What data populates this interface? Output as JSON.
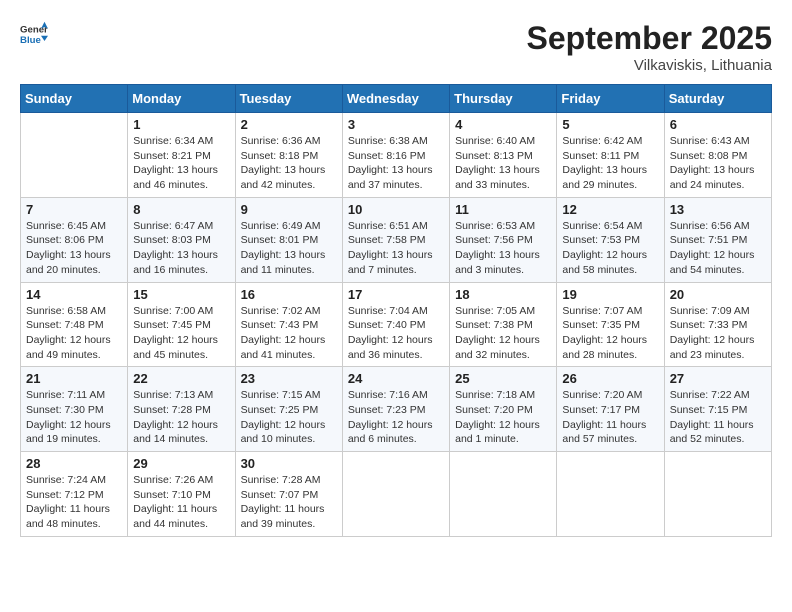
{
  "header": {
    "logo_general": "General",
    "logo_blue": "Blue",
    "month_title": "September 2025",
    "location": "Vilkaviskis, Lithuania"
  },
  "days_of_week": [
    "Sunday",
    "Monday",
    "Tuesday",
    "Wednesday",
    "Thursday",
    "Friday",
    "Saturday"
  ],
  "weeks": [
    [
      {
        "day": "",
        "info": ""
      },
      {
        "day": "1",
        "info": "Sunrise: 6:34 AM\nSunset: 8:21 PM\nDaylight: 13 hours\nand 46 minutes."
      },
      {
        "day": "2",
        "info": "Sunrise: 6:36 AM\nSunset: 8:18 PM\nDaylight: 13 hours\nand 42 minutes."
      },
      {
        "day": "3",
        "info": "Sunrise: 6:38 AM\nSunset: 8:16 PM\nDaylight: 13 hours\nand 37 minutes."
      },
      {
        "day": "4",
        "info": "Sunrise: 6:40 AM\nSunset: 8:13 PM\nDaylight: 13 hours\nand 33 minutes."
      },
      {
        "day": "5",
        "info": "Sunrise: 6:42 AM\nSunset: 8:11 PM\nDaylight: 13 hours\nand 29 minutes."
      },
      {
        "day": "6",
        "info": "Sunrise: 6:43 AM\nSunset: 8:08 PM\nDaylight: 13 hours\nand 24 minutes."
      }
    ],
    [
      {
        "day": "7",
        "info": "Sunrise: 6:45 AM\nSunset: 8:06 PM\nDaylight: 13 hours\nand 20 minutes."
      },
      {
        "day": "8",
        "info": "Sunrise: 6:47 AM\nSunset: 8:03 PM\nDaylight: 13 hours\nand 16 minutes."
      },
      {
        "day": "9",
        "info": "Sunrise: 6:49 AM\nSunset: 8:01 PM\nDaylight: 13 hours\nand 11 minutes."
      },
      {
        "day": "10",
        "info": "Sunrise: 6:51 AM\nSunset: 7:58 PM\nDaylight: 13 hours\nand 7 minutes."
      },
      {
        "day": "11",
        "info": "Sunrise: 6:53 AM\nSunset: 7:56 PM\nDaylight: 13 hours\nand 3 minutes."
      },
      {
        "day": "12",
        "info": "Sunrise: 6:54 AM\nSunset: 7:53 PM\nDaylight: 12 hours\nand 58 minutes."
      },
      {
        "day": "13",
        "info": "Sunrise: 6:56 AM\nSunset: 7:51 PM\nDaylight: 12 hours\nand 54 minutes."
      }
    ],
    [
      {
        "day": "14",
        "info": "Sunrise: 6:58 AM\nSunset: 7:48 PM\nDaylight: 12 hours\nand 49 minutes."
      },
      {
        "day": "15",
        "info": "Sunrise: 7:00 AM\nSunset: 7:45 PM\nDaylight: 12 hours\nand 45 minutes."
      },
      {
        "day": "16",
        "info": "Sunrise: 7:02 AM\nSunset: 7:43 PM\nDaylight: 12 hours\nand 41 minutes."
      },
      {
        "day": "17",
        "info": "Sunrise: 7:04 AM\nSunset: 7:40 PM\nDaylight: 12 hours\nand 36 minutes."
      },
      {
        "day": "18",
        "info": "Sunrise: 7:05 AM\nSunset: 7:38 PM\nDaylight: 12 hours\nand 32 minutes."
      },
      {
        "day": "19",
        "info": "Sunrise: 7:07 AM\nSunset: 7:35 PM\nDaylight: 12 hours\nand 28 minutes."
      },
      {
        "day": "20",
        "info": "Sunrise: 7:09 AM\nSunset: 7:33 PM\nDaylight: 12 hours\nand 23 minutes."
      }
    ],
    [
      {
        "day": "21",
        "info": "Sunrise: 7:11 AM\nSunset: 7:30 PM\nDaylight: 12 hours\nand 19 minutes."
      },
      {
        "day": "22",
        "info": "Sunrise: 7:13 AM\nSunset: 7:28 PM\nDaylight: 12 hours\nand 14 minutes."
      },
      {
        "day": "23",
        "info": "Sunrise: 7:15 AM\nSunset: 7:25 PM\nDaylight: 12 hours\nand 10 minutes."
      },
      {
        "day": "24",
        "info": "Sunrise: 7:16 AM\nSunset: 7:23 PM\nDaylight: 12 hours\nand 6 minutes."
      },
      {
        "day": "25",
        "info": "Sunrise: 7:18 AM\nSunset: 7:20 PM\nDaylight: 12 hours\nand 1 minute."
      },
      {
        "day": "26",
        "info": "Sunrise: 7:20 AM\nSunset: 7:17 PM\nDaylight: 11 hours\nand 57 minutes."
      },
      {
        "day": "27",
        "info": "Sunrise: 7:22 AM\nSunset: 7:15 PM\nDaylight: 11 hours\nand 52 minutes."
      }
    ],
    [
      {
        "day": "28",
        "info": "Sunrise: 7:24 AM\nSunset: 7:12 PM\nDaylight: 11 hours\nand 48 minutes."
      },
      {
        "day": "29",
        "info": "Sunrise: 7:26 AM\nSunset: 7:10 PM\nDaylight: 11 hours\nand 44 minutes."
      },
      {
        "day": "30",
        "info": "Sunrise: 7:28 AM\nSunset: 7:07 PM\nDaylight: 11 hours\nand 39 minutes."
      },
      {
        "day": "",
        "info": ""
      },
      {
        "day": "",
        "info": ""
      },
      {
        "day": "",
        "info": ""
      },
      {
        "day": "",
        "info": ""
      }
    ]
  ]
}
